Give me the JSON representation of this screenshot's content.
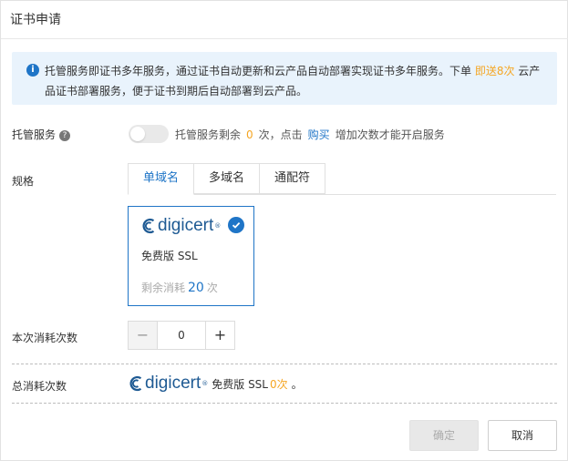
{
  "dialog": {
    "title": "证书申请"
  },
  "notice": {
    "text_before": "托管服务即证书多年服务，通过证书自动更新和云产品自动部署实现证书多年服务。下单 ",
    "highlight": "即送8次",
    "text_after": " 云产品证书部署服务，便于证书到期后自动部署到云产品。"
  },
  "hosting": {
    "label": "托管服务",
    "help_icon": "?",
    "text_before": "托管服务剩余",
    "count": "0",
    "text_mid": "次，点击",
    "buy_link": "购买",
    "text_after": "增加次数才能开启服务",
    "enabled": false
  },
  "spec": {
    "label": "规格",
    "tabs": [
      {
        "label": "单域名",
        "active": true
      },
      {
        "label": "多域名",
        "active": false
      },
      {
        "label": "通配符",
        "active": false
      }
    ]
  },
  "product_card": {
    "brand": "digicert",
    "reg_mark": "®",
    "name": "免费版 SSL",
    "remain_label": "剩余消耗",
    "remain_count": "20",
    "remain_unit": "次",
    "selected": true
  },
  "consume": {
    "label": "本次消耗次数",
    "minus": "−",
    "value": "0",
    "plus": "+"
  },
  "total": {
    "label": "总消耗次数",
    "brand": "digicert",
    "reg_mark": "®",
    "product": "免费版 SSL",
    "count": "0次",
    "suffix": "。"
  },
  "footer": {
    "ok_label": "确定",
    "cancel_label": "取消"
  },
  "colors": {
    "accent": "#1f75c7",
    "highlight": "#f5a623",
    "notice_bg": "#e9f3fc",
    "brand": "#1e5a93"
  }
}
